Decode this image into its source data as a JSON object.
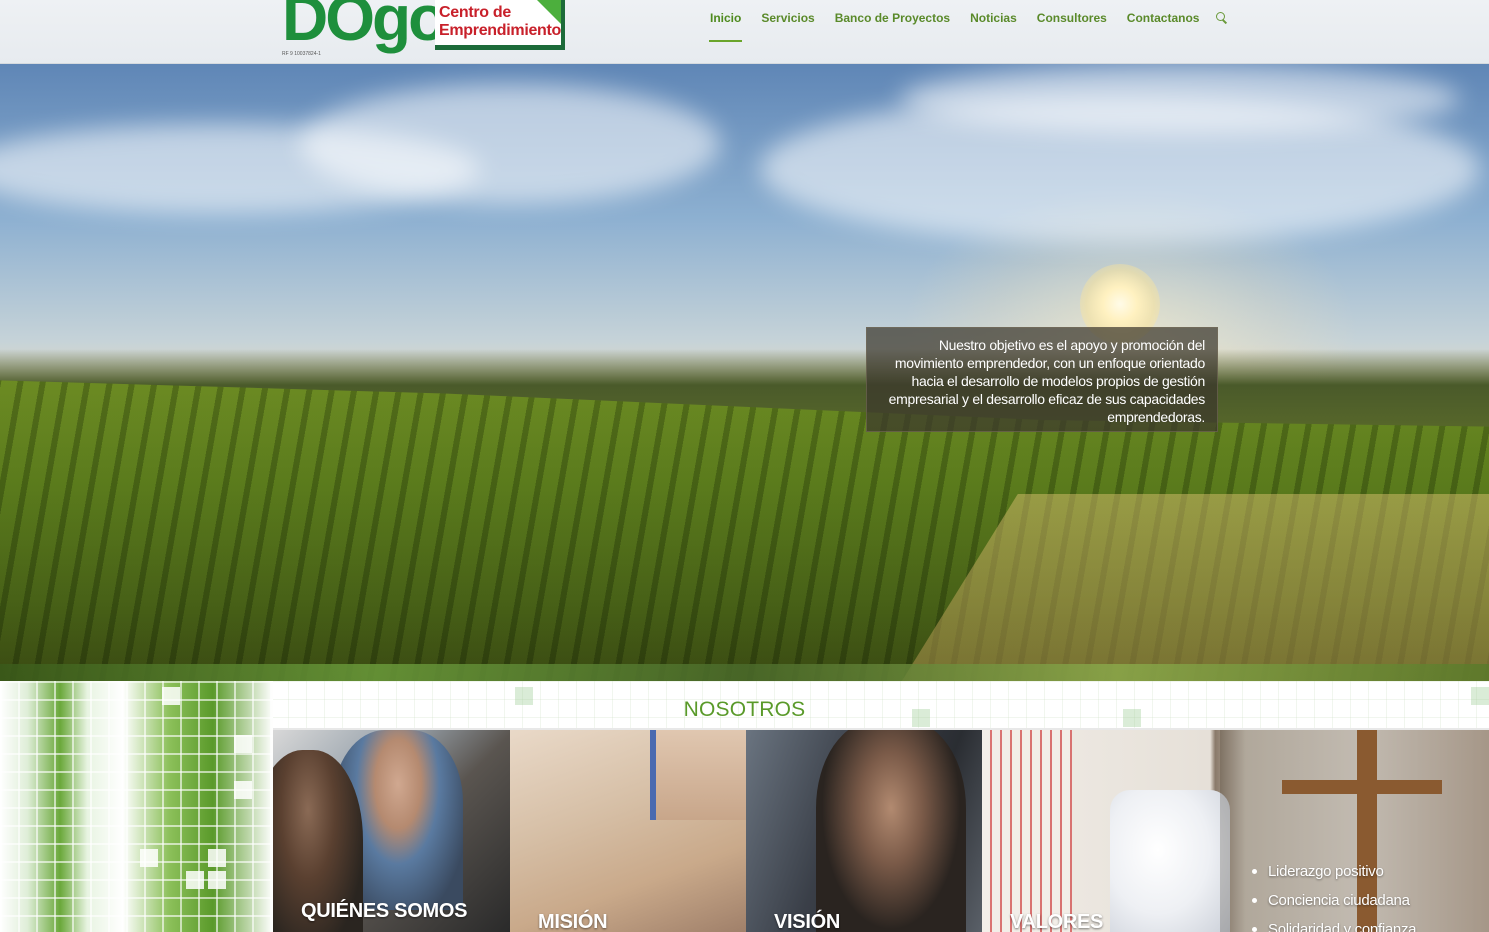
{
  "header": {
    "logo": {
      "wordmark": "DOgo",
      "tagline_line1": "Centro de",
      "tagline_line2": "Emprendimiento",
      "registry": "RF 9 10037824-1"
    },
    "nav": [
      {
        "label": "Inicio",
        "active": true
      },
      {
        "label": "Servicios",
        "active": false
      },
      {
        "label": "Banco de Proyectos",
        "active": false
      },
      {
        "label": "Noticias",
        "active": false
      },
      {
        "label": "Consultores",
        "active": false
      },
      {
        "label": "Contactanos",
        "active": false
      }
    ],
    "search_icon": "search-icon"
  },
  "hero": {
    "caption": "Nuestro objetivo es el apoyo y promoción del movimiento emprendedor, con un enfoque orientado hacia el desarrollo de modelos propios de gestión empresarial y el desarrollo eficaz de sus capacidades emprendedoras."
  },
  "nosotros": {
    "title": "NOSOTROS",
    "cards": [
      {
        "label": "QUIÉNES SOMOS"
      },
      {
        "label": "MISIÓN"
      },
      {
        "label": "VISIÓN"
      },
      {
        "label": "VALORES"
      }
    ],
    "values": [
      "Liderazgo positivo",
      "Conciencia ciudadana",
      "Solidaridad y confianza"
    ]
  },
  "colors": {
    "accent": "#5a9a2a",
    "logo_red": "#c8202a",
    "logo_green": "#1e8f3c"
  }
}
